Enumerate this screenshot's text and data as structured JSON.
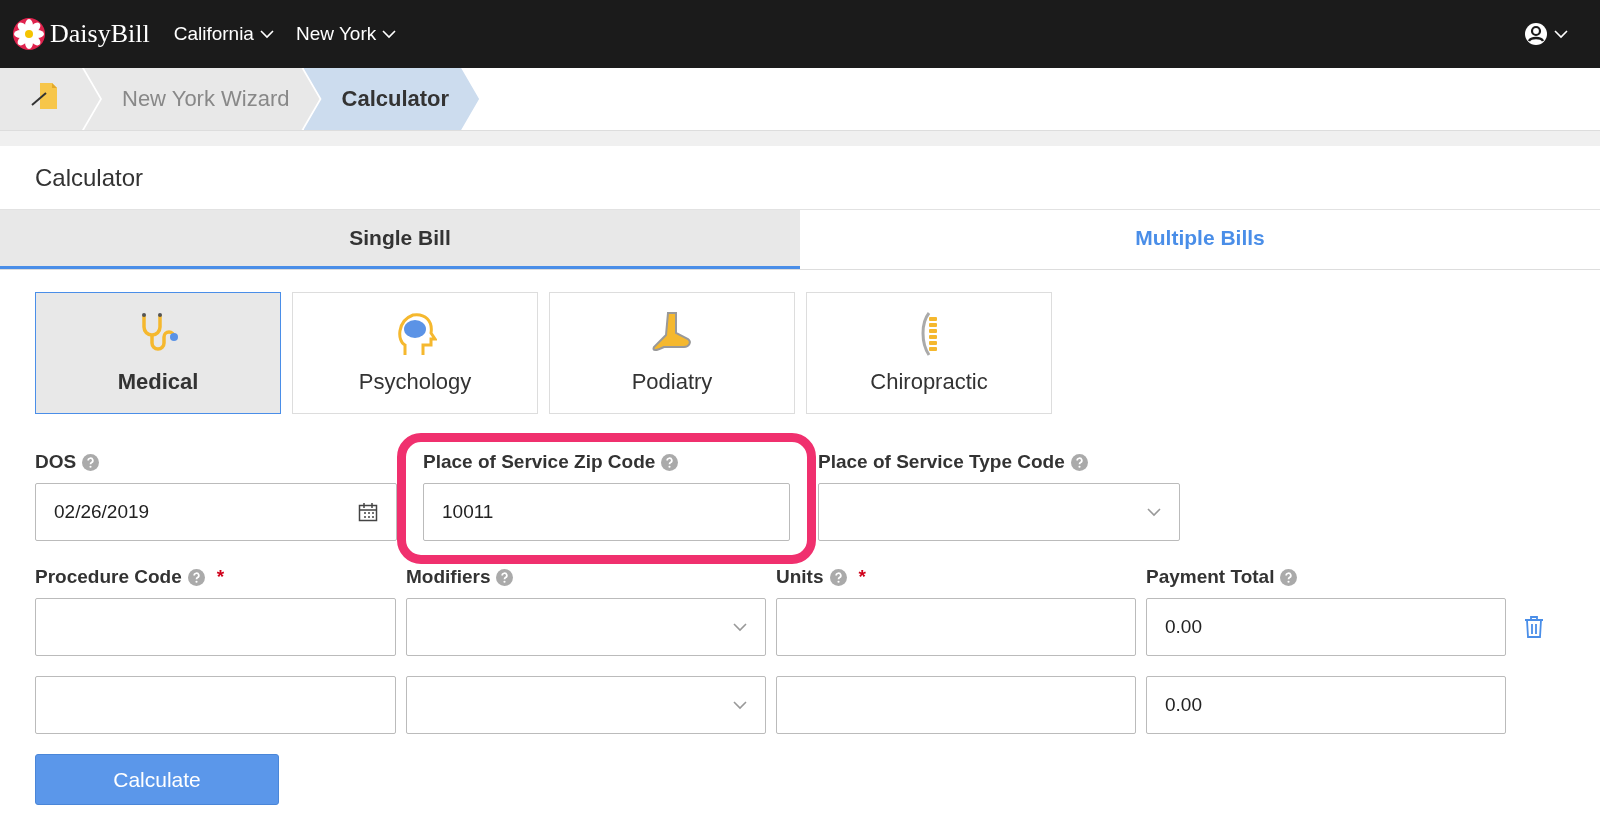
{
  "navbar": {
    "logo": "DaisyBill",
    "menus": [
      {
        "label": "California"
      },
      {
        "label": "New York"
      }
    ]
  },
  "breadcrumb": [
    {
      "label": "New York Wizard",
      "selected": false
    },
    {
      "label": "Calculator",
      "selected": true
    }
  ],
  "page_title": "Calculator",
  "tabs": [
    {
      "label": "Single Bill",
      "selected": true
    },
    {
      "label": "Multiple Bills",
      "selected": false
    }
  ],
  "specialties": [
    {
      "label": "Medical",
      "kind": "stethoscope",
      "selected": true
    },
    {
      "label": "Psychology",
      "kind": "brain",
      "selected": false
    },
    {
      "label": "Podiatry",
      "kind": "foot",
      "selected": false
    },
    {
      "label": "Chiropractic",
      "kind": "spine",
      "selected": false
    }
  ],
  "fields": [
    {
      "kind": "date",
      "label": "DOS",
      "value": "02/26/2019"
    },
    {
      "kind": "text",
      "label": "Place of Service Zip Code",
      "value": "10011",
      "highlighted": true
    },
    {
      "kind": "select",
      "label": "Place of Service Type Code"
    }
  ],
  "line_items": {
    "columns": [
      {
        "label": "Procedure Code",
        "kind": "text",
        "required_mark": "*"
      },
      {
        "label": "Modifiers",
        "kind": "select"
      },
      {
        "label": "Units",
        "kind": "text",
        "required_mark": "*"
      },
      {
        "label": "Payment Total",
        "kind": "amount"
      }
    ],
    "rows": [
      {
        "payment_total": "0.00",
        "deletable": true
      },
      {
        "payment_total": "0.00",
        "deletable": false
      }
    ]
  },
  "calculate_button": "Calculate"
}
